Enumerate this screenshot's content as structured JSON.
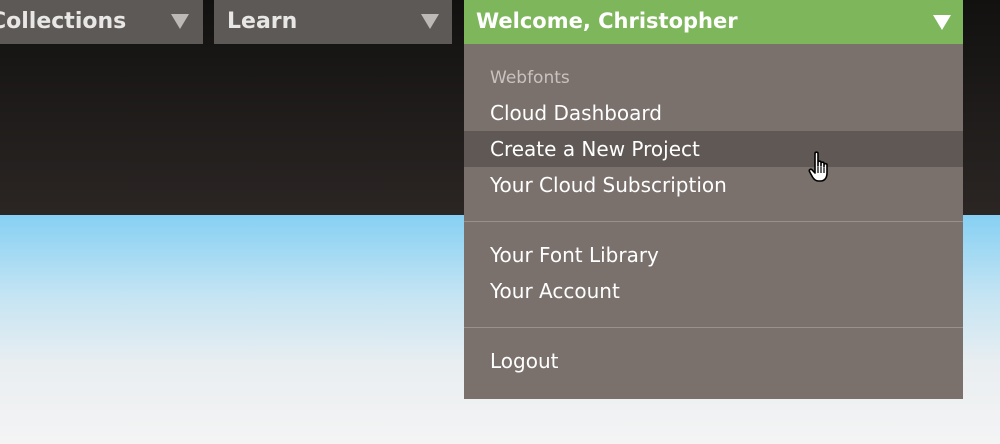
{
  "nav": {
    "tabs": [
      {
        "label": "Collections"
      },
      {
        "label": "Learn"
      }
    ],
    "welcome_label": "Welcome, Christopher"
  },
  "dropdown": {
    "heading": "Webfonts",
    "group1": [
      "Cloud Dashboard",
      "Create a New Project",
      "Your Cloud Subscription"
    ],
    "group2": [
      "Your Font Library",
      "Your Account"
    ],
    "group3": [
      "Logout"
    ],
    "hovered_item": "Create a New Project"
  },
  "icons": {
    "tab_caret": "chevron-down-icon",
    "cursor": "hand-pointer-cursor-icon"
  },
  "colors": {
    "welcome_tab": "#7db65b",
    "nav_tab": "#5d5956",
    "dropdown_bg": "#7a716d",
    "hover_bg": "#5f5855"
  }
}
